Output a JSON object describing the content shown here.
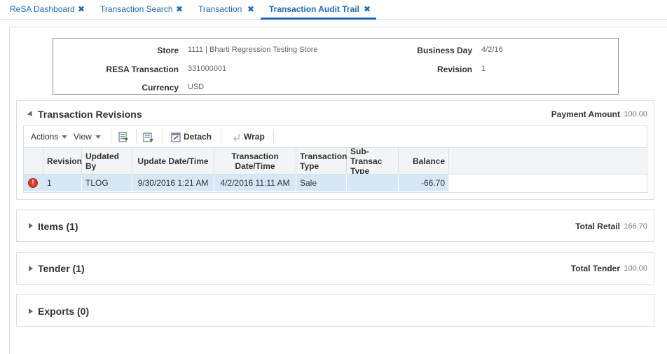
{
  "tabs": [
    {
      "label": "ReSA Dashboard",
      "close": "✖"
    },
    {
      "label": "Transaction Search",
      "close": "✖"
    },
    {
      "label": "Transaction",
      "close": "✖"
    },
    {
      "label": "Transaction Audit Trail",
      "close": "✖"
    }
  ],
  "header": {
    "store_label": "Store",
    "store_value": "1111 | Bharti Regression Testing Store",
    "resa_label": "RESA Transaction",
    "resa_value": "331000001",
    "currency_label": "Currency",
    "currency_value": "USD",
    "business_day_label": "Business Day",
    "business_day_value": "4/2/16",
    "revision_label": "Revision",
    "revision_value": "1"
  },
  "revisions": {
    "title": "Transaction Revisions",
    "summary_label": "Payment Amount",
    "summary_value": "100.00",
    "toolbar": {
      "actions": "Actions",
      "view": "View",
      "detach": "Detach",
      "wrap": "Wrap"
    },
    "columns": [
      "Revision",
      "Updated By",
      "Update Date/Time",
      "Transaction Date/Time",
      "Transaction Type",
      "Sub-Transac Type",
      "Balance"
    ],
    "rows": [
      {
        "revision": "1",
        "updated_by": "TLOG",
        "update_dt": "9/30/2016 1:21 AM",
        "txn_dt": "4/2/2016 11:11 AM",
        "txn_type": "Sale",
        "sub_type": "",
        "balance": "-66.70"
      }
    ]
  },
  "items": {
    "title": "Items (1)",
    "summary_label": "Total Retail",
    "summary_value": "166.70"
  },
  "tender": {
    "title": "Tender (1)",
    "summary_label": "Total Tender",
    "summary_value": "100.00"
  },
  "exports": {
    "title": "Exports (0)"
  },
  "colors": {
    "accent": "#1f6bb1",
    "row_selected": "#d6e8f7",
    "error": "#e03a2e"
  }
}
